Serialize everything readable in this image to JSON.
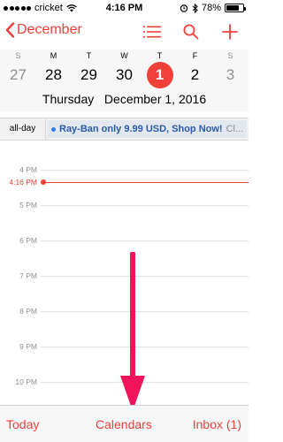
{
  "status_bar": {
    "carrier": "cricket",
    "time": "4:16 PM",
    "battery": "78%",
    "battery_level": 0.78
  },
  "nav": {
    "back_label": "December",
    "icons": [
      "list-icon",
      "search-icon",
      "plus-icon"
    ]
  },
  "week": {
    "days": [
      {
        "letter": "S",
        "date": "27",
        "weekend": true
      },
      {
        "letter": "M",
        "date": "28",
        "weekend": false
      },
      {
        "letter": "T",
        "date": "29",
        "weekend": false
      },
      {
        "letter": "W",
        "date": "30",
        "weekend": false
      },
      {
        "letter": "T",
        "date": "1",
        "weekend": false,
        "today": true
      },
      {
        "letter": "F",
        "date": "2",
        "weekend": false
      },
      {
        "letter": "S",
        "date": "3",
        "weekend": true
      }
    ],
    "selected_weekday": "Thursday",
    "selected_date": "December 1, 2016"
  },
  "all_day": {
    "label": "all-day",
    "event_title": "Ray-Ban only 9.99 USD, Shop Now!",
    "event_suffix": "Cl..."
  },
  "timeline": {
    "hours": [
      "4 PM",
      "5 PM",
      "6 PM",
      "7 PM",
      "8 PM",
      "9 PM",
      "10 PM"
    ],
    "now_label": "4:16 PM"
  },
  "toolbar": {
    "today": "Today",
    "calendars": "Calendars",
    "inbox": "Inbox (1)"
  },
  "colors": {
    "accent": "#f0403a",
    "annotation_arrow": "#f0145a"
  }
}
